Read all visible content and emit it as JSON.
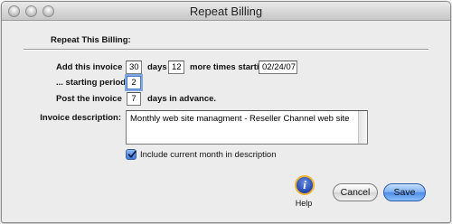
{
  "window": {
    "title": "Repeat Billing",
    "controls": [
      "close-button",
      "minimize-button",
      "zoom-button"
    ]
  },
  "header": {
    "section_label": "Repeat This Billing:"
  },
  "form": {
    "add_invoice_label": "Add this invoice",
    "interval_value": "30",
    "days_label": "days",
    "times_value": "12",
    "more_times_label": "more times starting",
    "start_date": "02/24/07",
    "starting_period_label": "... starting period:",
    "starting_period_value": "2",
    "post_invoice_label": "Post the invoice",
    "advance_days_value": "7",
    "days_in_advance_label": "days in advance.",
    "description_label": "Invoice description:",
    "description_value": "Monthly web site managment - Reseller Channel web site",
    "include_month_label": "Include current month in description",
    "include_month_checked": true
  },
  "footer": {
    "help_label": "Help",
    "cancel_label": "Cancel",
    "save_label": "Save"
  },
  "colors": {
    "window_bg": "#ececec",
    "accent_blue": "#4b8ae8",
    "help_ring": "#f0b030"
  }
}
